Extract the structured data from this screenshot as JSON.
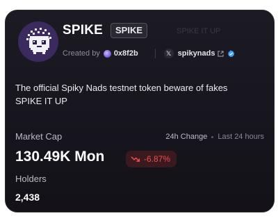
{
  "token": {
    "name": "SPIKE",
    "ticker": "SPIKE",
    "avatar_icon": "spiky-creature-avatar",
    "ghost_text": "SPIKE IT UP"
  },
  "creator": {
    "created_by_label": "Created by",
    "address": "0x8f2b"
  },
  "social": {
    "platform_icon": "x-icon",
    "platform_glyph": "𝕏",
    "handle": "spikynads",
    "verified": true
  },
  "description": {
    "lines": [
      "The official Spiky Nads testnet token beware of fakes",
      "SPIKE IT UP"
    ]
  },
  "market": {
    "market_cap_label": "Market Cap",
    "market_cap_value": "130.49K Mon",
    "change_label": "24h Change",
    "change_period": "Last 24 hours",
    "change_value": "-6.87%",
    "change_direction": "down"
  },
  "holders": {
    "label": "Holders",
    "value": "2,438"
  },
  "colors": {
    "card_bg": "#1a1820",
    "negative": "#f04d4d",
    "negative_bg": "#3a1a1f",
    "avatar_bg": "#3a2a5e",
    "verified": "#3aa0ff"
  }
}
